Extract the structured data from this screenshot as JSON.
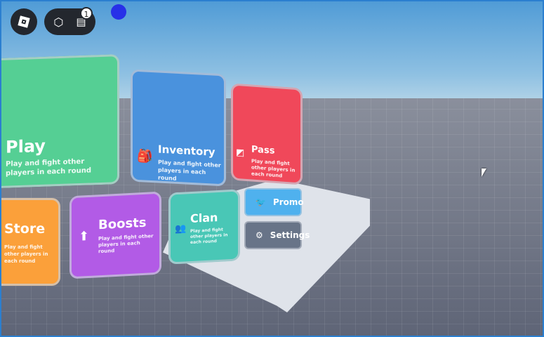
{
  "hud": {
    "roblox_menu": "roblox-logo",
    "avatar_button": "avatar-icon",
    "chat_button": "chat-icon",
    "chat_badge": "1"
  },
  "cards": [
    {
      "title": "Play",
      "desc": "Play and fight other players in each round",
      "color": "#55cf94"
    },
    {
      "title": "Inventory",
      "desc": "Play and fight other players in each round",
      "color": "#4a92dd",
      "icon": "backpack-icon"
    },
    {
      "title": "Pass",
      "desc": "Play and fight other players in each round",
      "color": "#f0485a",
      "icon": "pass-icon"
    },
    {
      "title": "Store",
      "desc": "Play and fight other players in each round",
      "color": "#fba03a"
    },
    {
      "title": "Boosts",
      "desc": "Play and fight other players in each round",
      "color": "#b25be6",
      "icon": "arrow-up-icon"
    },
    {
      "title": "Clan",
      "desc": "Play and fight other players in each round",
      "color": "#49c7b6",
      "icon": "users-icon"
    }
  ],
  "buttons": [
    {
      "label": "Promo",
      "color": "#4fb1ee",
      "icon": "twitter-icon"
    },
    {
      "label": "Settings",
      "color": "#687488",
      "icon": "settings-icon"
    }
  ]
}
